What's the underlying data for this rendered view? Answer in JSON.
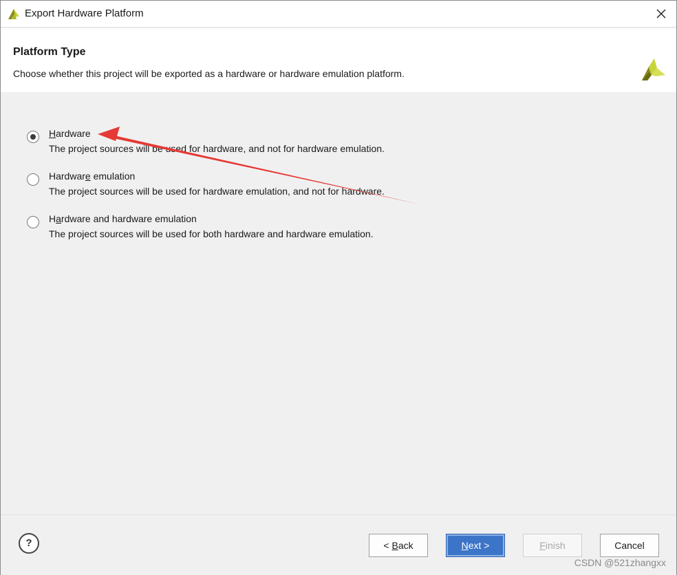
{
  "window": {
    "title": "Export Hardware Platform"
  },
  "header": {
    "title": "Platform Type",
    "description": "Choose whether this project will be exported as a hardware or hardware emulation platform."
  },
  "options": [
    {
      "label_pre": "",
      "label_key": "H",
      "label_post": "ardware",
      "description": "The project sources will be used for hardware, and not for hardware emulation.",
      "selected": true
    },
    {
      "label_pre": "Hardwar",
      "label_key": "e",
      "label_post": " emulation",
      "description": "The project sources will be used for hardware emulation, and not for hardware.",
      "selected": false
    },
    {
      "label_pre": "H",
      "label_key": "a",
      "label_post": "rdware and hardware emulation",
      "description": "The project sources will be used for both hardware and hardware emulation.",
      "selected": false
    }
  ],
  "footer": {
    "help_label": "?",
    "back_pre": "< ",
    "back_key": "B",
    "back_post": "ack",
    "next_pre": "",
    "next_key": "N",
    "next_post": "ext >",
    "finish_pre": "",
    "finish_key": "F",
    "finish_post": "inish",
    "cancel_label": "Cancel"
  },
  "watermark": "CSDN @521zhangxx",
  "icons": {
    "title_logo": "vivado-logo-icon",
    "header_logo": "vivado-logo-icon",
    "close": "close-icon"
  },
  "colors": {
    "accent": "#3c74c8",
    "arrow": "#e53935",
    "logo_yellow": "#c8d43c",
    "logo_olive": "#8a8a1e"
  }
}
